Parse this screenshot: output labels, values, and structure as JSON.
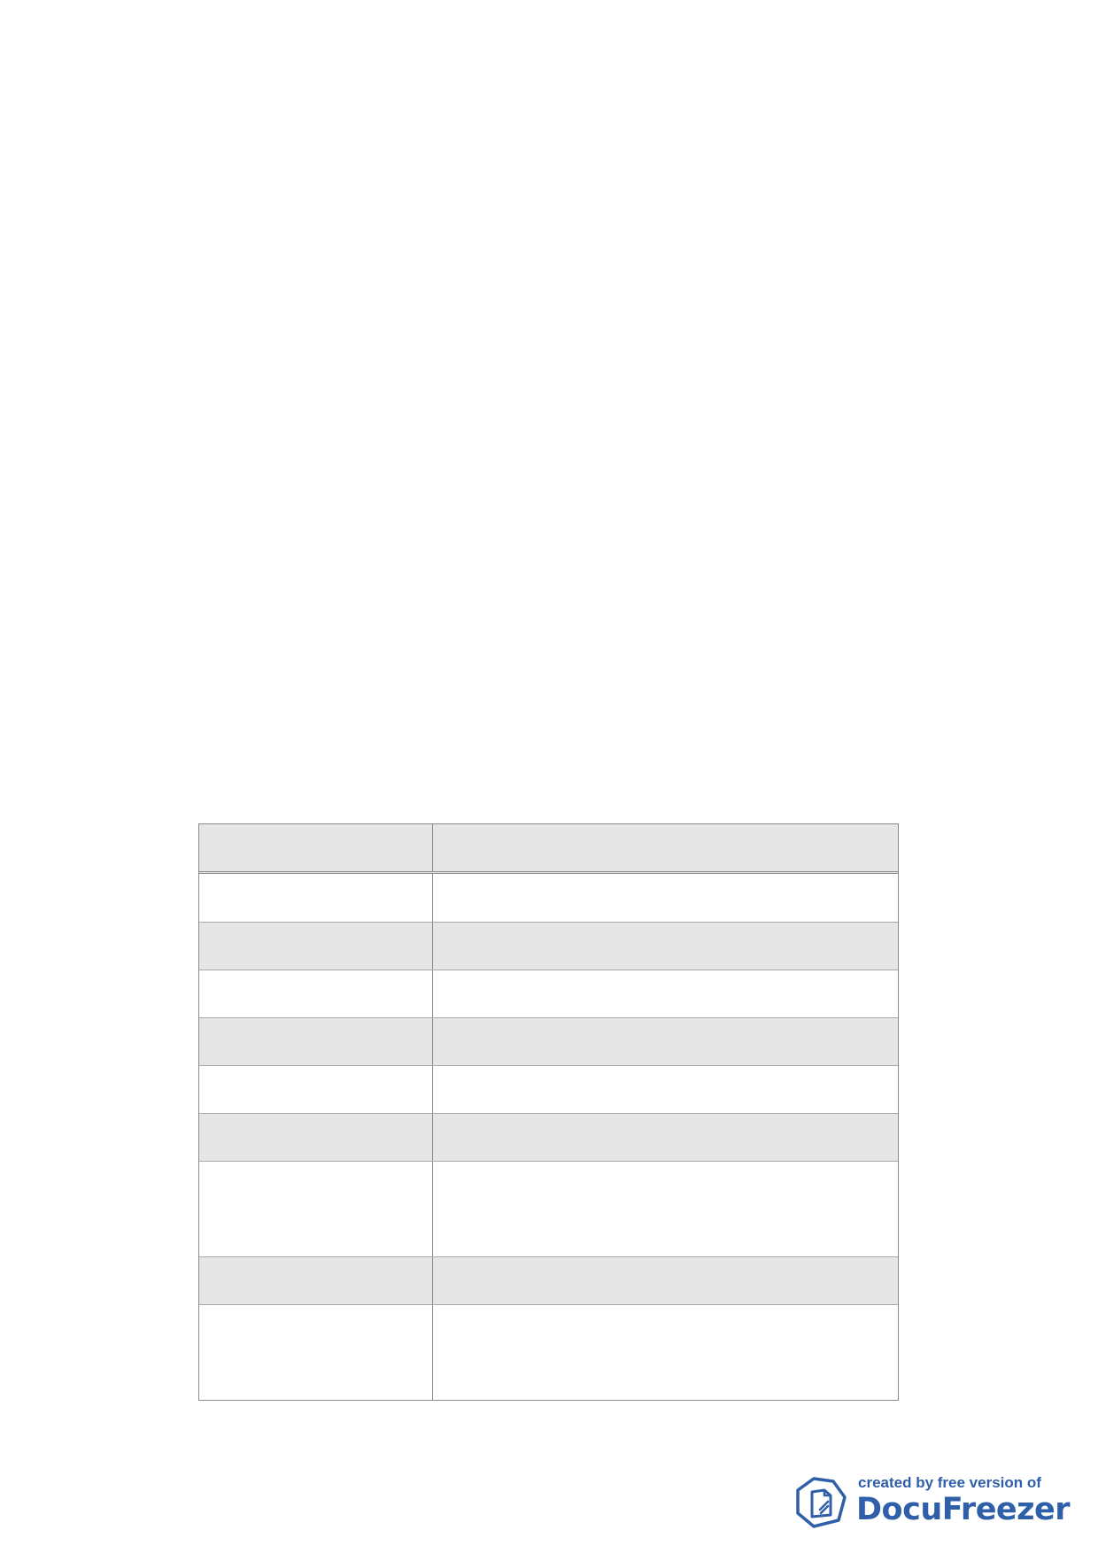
{
  "table": {
    "header": [
      "",
      ""
    ],
    "rows": [
      [
        "",
        ""
      ],
      [
        "",
        ""
      ],
      [
        "",
        ""
      ],
      [
        "",
        ""
      ],
      [
        "",
        ""
      ],
      [
        "",
        ""
      ],
      [
        "",
        ""
      ],
      [
        "",
        ""
      ],
      [
        "",
        ""
      ]
    ]
  },
  "watermark": {
    "line1": "created by free version of",
    "line2": "DocuFreezer",
    "brand_color": "#2f5fa8",
    "icon": "docufreezer-logo-icon"
  },
  "colors": {
    "shaded_row": "#e6e6e6",
    "border": "#8a8a8a"
  }
}
